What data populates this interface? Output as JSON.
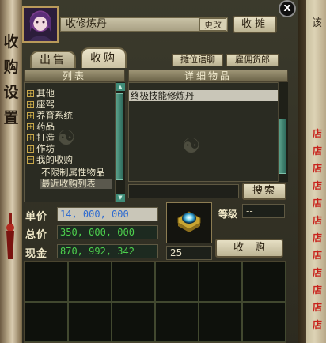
{
  "left_scroll": {
    "chars": [
      "收",
      "购",
      "设",
      "置"
    ]
  },
  "header": {
    "stall_name": "收修炼丹",
    "rename_label": "更改",
    "stall_button": "收摊",
    "close_label": "x"
  },
  "tabs": [
    {
      "label": "出售",
      "active": false
    },
    {
      "label": "收购",
      "active": true
    }
  ],
  "toolbar": {
    "seat_label": "摊位语聊",
    "hire_label": "雇佣货郎"
  },
  "list": {
    "header": "列表",
    "items": [
      {
        "label": "其他",
        "kind": "plus"
      },
      {
        "label": "座驾",
        "kind": "plus"
      },
      {
        "label": "养育系统",
        "kind": "plus"
      },
      {
        "label": "药品",
        "kind": "plus"
      },
      {
        "label": "打造",
        "kind": "plus"
      },
      {
        "label": "作坊",
        "kind": "plus"
      },
      {
        "label": "我的收购",
        "kind": "minus"
      },
      {
        "label": "不限制属性物品",
        "kind": "child"
      },
      {
        "label": "最近收购列表",
        "kind": "child-selected"
      }
    ]
  },
  "detail": {
    "header": "详细物品",
    "rows": [
      "终极技能修炼丹"
    ],
    "search_label": "搜索"
  },
  "prices": {
    "unit_label": "单价",
    "unit_value": "14, 000, 000",
    "total_label": "总价",
    "total_value": "350, 000, 000",
    "cash_label": "现金",
    "cash_value": "870, 992, 342",
    "grade_label": "等级",
    "grade_value": "--",
    "quantity": "25",
    "buy_label": "收购"
  },
  "right_strip": {
    "top_char": "该",
    "shop_chars": [
      "店",
      "店",
      "店",
      "店",
      "店",
      "店",
      "店",
      "店",
      "店",
      "店",
      "店",
      "店"
    ]
  },
  "colors": {
    "accent_green": "#4dd14d",
    "accent_blue": "#2f6bd0",
    "shop_red": "#c8231c"
  },
  "icons": [
    "close-icon",
    "plus-icon",
    "minus-icon",
    "gem-icon",
    "scroll-arrow-icon"
  ]
}
